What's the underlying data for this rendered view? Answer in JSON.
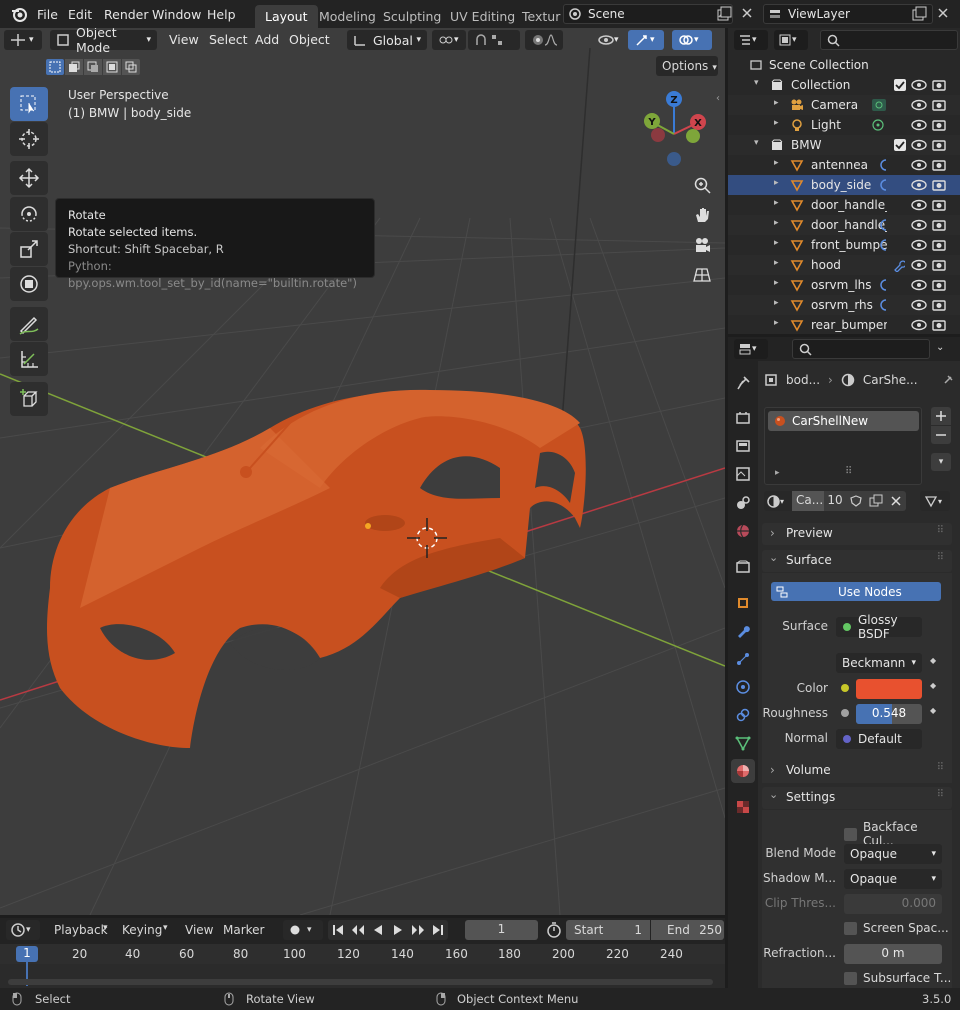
{
  "menus": [
    "File",
    "Edit",
    "Render",
    "Window",
    "Help"
  ],
  "workspaces": [
    "Layout",
    "Modeling",
    "Sculpting",
    "UV Editing",
    "Textur"
  ],
  "scene": "Scene",
  "view_layer": "ViewLayer",
  "viewport": {
    "mode": "Object Mode",
    "menus": [
      "View",
      "Select",
      "Add",
      "Object"
    ],
    "orientation": "Global",
    "options": "Options",
    "perspective": "User Perspective",
    "active": "(1) BMW | body_side",
    "axes": {
      "x": "X",
      "y": "Y",
      "z": "Z"
    }
  },
  "tooltip": {
    "title": "Rotate",
    "desc": "Rotate selected items.",
    "shortcut": "Shortcut: Shift Spacebar, R",
    "python": "Python: bpy.ops.wm.tool_set_by_id(name=\"builtin.rotate\")"
  },
  "outliner": {
    "root": "Scene Collection",
    "rows": [
      {
        "name": "Collection",
        "type": "collection"
      },
      {
        "name": "Camera",
        "type": "camera"
      },
      {
        "name": "Light",
        "type": "light"
      },
      {
        "name": "BMW",
        "type": "collection"
      },
      {
        "name": "antennea",
        "type": "mesh"
      },
      {
        "name": "body_side",
        "type": "mesh"
      },
      {
        "name": "door_handle_lhs",
        "type": "mesh"
      },
      {
        "name": "door_handle_rhs",
        "type": "mesh"
      },
      {
        "name": "front_bumper",
        "type": "mesh"
      },
      {
        "name": "hood",
        "type": "mesh"
      },
      {
        "name": "osrvm_lhs",
        "type": "mesh"
      },
      {
        "name": "osrvm_rhs",
        "type": "mesh"
      },
      {
        "name": "rear_bumper",
        "type": "mesh"
      }
    ]
  },
  "properties": {
    "breadcrumb_object": "bod...",
    "breadcrumb_material": "CarShe...",
    "slot": "CarShellNew",
    "mat_name": "Ca...",
    "users": "10",
    "panels": {
      "preview": "Preview",
      "surface": "Surface",
      "volume": "Volume",
      "settings": "Settings"
    },
    "use_nodes": "Use Nodes",
    "surface_label": "Surface",
    "surface_value": "Glossy BSDF",
    "distribution": "Beckmann",
    "color_label": "Color",
    "color": "#e8512f",
    "roughness_label": "Roughness",
    "roughness": "0.548",
    "normal_label": "Normal",
    "normal_value": "Default",
    "backface": "Backface Cul...",
    "blend_label": "Blend Mode",
    "blend_value": "Opaque",
    "shadow_label": "Shadow M...",
    "shadow_value": "Opaque",
    "clip_label": "Clip Thres...",
    "clip_value": "0.000",
    "screen_space": "Screen Spac...",
    "refraction_label": "Refraction...",
    "refraction_value": "0 m",
    "subsurface": "Subsurface T..."
  },
  "timeline": {
    "menus": [
      "Playback",
      "Keying",
      "View",
      "Marker"
    ],
    "current_frame": "1",
    "start_label": "Start",
    "start": "1",
    "end_label": "End",
    "end": "250",
    "ticks": [
      "1",
      "20",
      "40",
      "60",
      "80",
      "100",
      "120",
      "140",
      "160",
      "180",
      "200",
      "220",
      "240"
    ]
  },
  "status": {
    "select": "Select",
    "rotate": "Rotate View",
    "context": "Object Context Menu",
    "version": "3.5.0"
  },
  "colors": {
    "accent": "#4772b3",
    "car": "#c8501f",
    "x_axis": "#d0454d",
    "y_axis": "#7ea63a",
    "z_axis": "#3a7bd5"
  }
}
